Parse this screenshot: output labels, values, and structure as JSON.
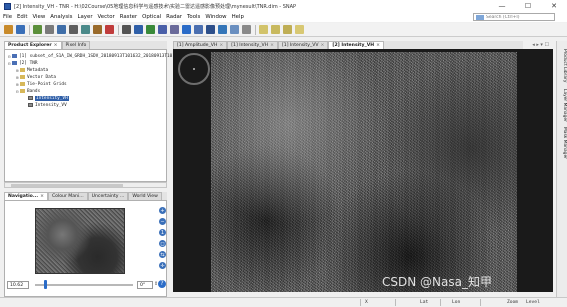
{
  "window": {
    "title": "[2] Intensity_VH - TNR - H:\\02Course\\05地理信息科学与遥感技术\\实验二雷达遥感影像预处理\\mynesult\\TNR.dim - SNAP",
    "controls": [
      "—",
      "☐",
      "✕"
    ]
  },
  "menu": {
    "items": [
      "File",
      "Edit",
      "View",
      "Analysis",
      "Layer",
      "Vector",
      "Raster",
      "Optical",
      "Radar",
      "Tools",
      "Window",
      "Help"
    ],
    "search_placeholder": "Search (Ctrl+I)"
  },
  "colors": {
    "accent": "#2b6cc8",
    "selection": "#2f5fa8",
    "viewport_bg": "#1a1a1a"
  },
  "explorer": {
    "tabs": [
      {
        "label": "Product Explorer",
        "active": true
      },
      {
        "label": "Pixel Info",
        "active": false
      }
    ],
    "tree": [
      {
        "indent": 0,
        "toggle": "⊟",
        "icon": "prod",
        "label": "[1] subset_of_S1A_IW_GRDH_1SDV_20180913T101632_20180913T1017"
      },
      {
        "indent": 0,
        "toggle": "⊟",
        "icon": "prod",
        "label": "[2] TNR"
      },
      {
        "indent": 1,
        "toggle": "⊞",
        "icon": "folder",
        "label": "Metadata"
      },
      {
        "indent": 1,
        "toggle": "⊞",
        "icon": "folder",
        "label": "Vector Data"
      },
      {
        "indent": 1,
        "toggle": "⊞",
        "icon": "folder",
        "label": "Tie-Point Grids"
      },
      {
        "indent": 1,
        "toggle": "⊟",
        "icon": "folder",
        "label": "Bands"
      },
      {
        "indent": 2,
        "toggle": "",
        "icon": "band",
        "label": "Intensity_VH",
        "selected": true
      },
      {
        "indent": 2,
        "toggle": "",
        "icon": "band",
        "label": "Intensity_VV"
      }
    ]
  },
  "navigation": {
    "tabs": [
      {
        "label": "Navigatio...",
        "active": true
      },
      {
        "label": "Colour Mani...",
        "active": false
      },
      {
        "label": "Uncertainty ...",
        "active": false
      },
      {
        "label": "World View",
        "active": false
      }
    ],
    "zoom_value": "10.62",
    "zoom_level": 0.09,
    "rotation_value": "0°"
  },
  "editor": {
    "tabs": [
      {
        "label": "[1] Amplitude_VH",
        "active": false
      },
      {
        "label": "[1] Intensity_VH",
        "active": false
      },
      {
        "label": "[1] Intensity_VV",
        "active": false
      },
      {
        "label": "[2] Intensity_VH",
        "active": true
      }
    ],
    "panel_controls": "◂ ▸ ▾ ☐"
  },
  "right_panels": [
    "Product Library",
    "Layer Manager",
    "Mask Manager"
  ],
  "status": {
    "x": "X",
    "lat": "Lat",
    "lon": "Lon",
    "zoom": "Zoom",
    "level": "Level"
  },
  "watermark": "CSDN @Nasa_知甲"
}
